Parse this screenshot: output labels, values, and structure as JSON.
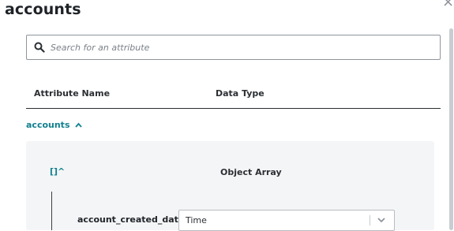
{
  "dialog": {
    "title": "accounts",
    "close_glyph": "×"
  },
  "search": {
    "placeholder": "Search for an attribute",
    "icon": "search-icon"
  },
  "table": {
    "headers": [
      "Attribute Name",
      "Data Type"
    ]
  },
  "group": {
    "label": "accounts",
    "chevron": "⌃",
    "expanded": true
  },
  "array_item": {
    "label": "[]^",
    "type": "Object Array",
    "children": [
      {
        "name": "account_created_date",
        "type_value": "Time"
      }
    ]
  },
  "colors": {
    "accent": "#11808f",
    "panel_bg": "#f4f5f6",
    "text": "#1f2328"
  }
}
